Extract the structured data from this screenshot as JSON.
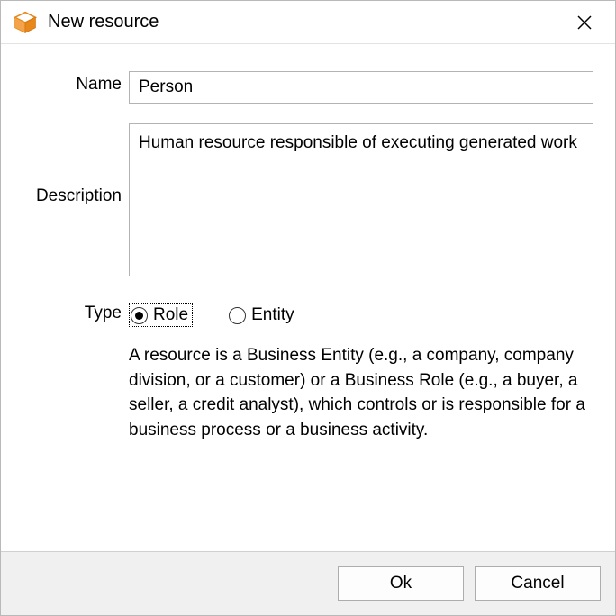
{
  "window": {
    "title": "New resource"
  },
  "form": {
    "name_label": "Name",
    "name_value": "Person",
    "description_label": "Description",
    "description_value": "Human resource responsible of executing generated work",
    "type_label": "Type",
    "type_options": {
      "role": "Role",
      "entity": "Entity"
    },
    "type_selected": "role",
    "help_text": "A resource is a Business Entity (e.g., a company, company division, or a customer) or a Business Role (e.g., a buyer, a seller, a credit analyst), which controls or is responsible for a business process or a business activity."
  },
  "buttons": {
    "ok": "Ok",
    "cancel": "Cancel"
  },
  "icons": {
    "app": "cube-icon",
    "close": "close-icon"
  }
}
